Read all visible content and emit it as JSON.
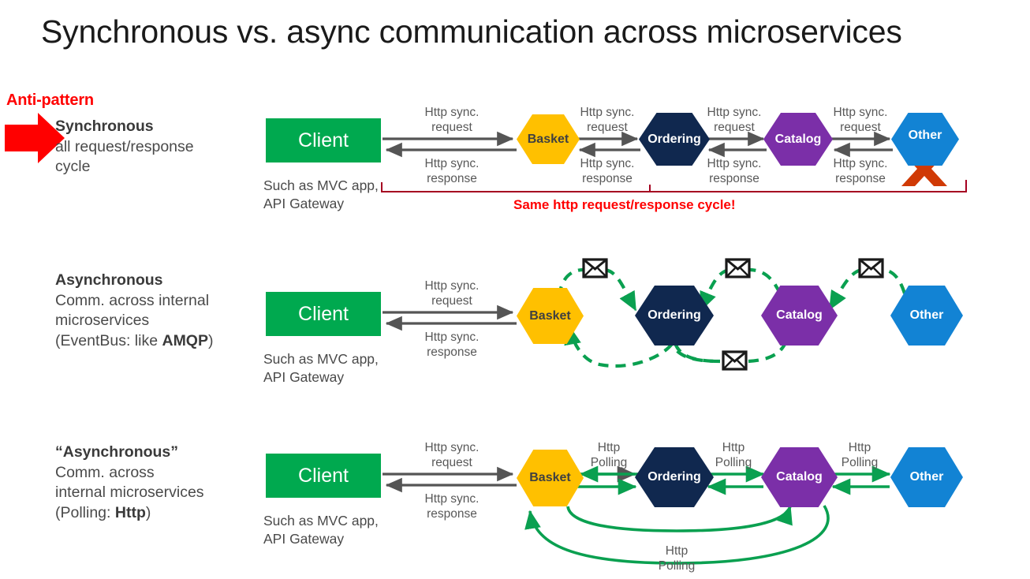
{
  "title": "Synchronous vs. async communication across microservices",
  "colors": {
    "client_green": "#00A94F",
    "basket_amber": "#FFC000",
    "ordering_navy": "#10284F",
    "catalog_purple": "#7B2FA8",
    "other_blue": "#1283D4",
    "arrow_gray": "#555555",
    "async_green": "#00A94F",
    "alert_red": "#FF0000",
    "bracket_red": "#A50021",
    "cross_orange": "#D03A05"
  },
  "rows": [
    {
      "id": "row-synchronous",
      "anti_pattern_label": "Anti-pattern",
      "heading": "Synchronous",
      "body_lines": [
        "all request/response",
        "cycle"
      ],
      "client": {
        "label": "Client",
        "caption_lines": [
          "Such as MVC app,",
          "API Gateway"
        ]
      },
      "services": [
        {
          "name": "Basket",
          "key": "basket"
        },
        {
          "name": "Ordering",
          "key": "ordering"
        },
        {
          "name": "Catalog",
          "key": "catalog"
        },
        {
          "name": "Other",
          "key": "other",
          "crossed_out": true
        }
      ],
      "link_captions": [
        {
          "top": "Http sync.\nrequest",
          "bottom": "Http sync.\nresponse"
        },
        {
          "top": "Http sync.\nrequest",
          "bottom": "Http sync.\nresponse"
        },
        {
          "top": "Http sync.\nrequest",
          "bottom": "Http sync.\nresponse"
        },
        {
          "top": "Http sync.\nrequest",
          "bottom": "Http sync.\nresponse"
        }
      ],
      "caption_top_1": "Http sync.",
      "caption_top_2": "request",
      "caption_bot_1": "Http sync.",
      "caption_bot_2": "response",
      "bracket_label": "Same http request/response  cycle!"
    },
    {
      "id": "row-asynchronous",
      "heading": "Asynchronous",
      "body_lines": [
        "Comm. across internal",
        "microservices",
        "(EventBus: like AMQP)"
      ],
      "body_line3_pre": "(EventBus: like ",
      "body_line3_bold": "AMQP",
      "body_line3_post": ")",
      "client": {
        "label": "Client",
        "caption_lines": [
          "Such as MVC app,",
          "API Gateway"
        ]
      },
      "services": [
        {
          "name": "Basket",
          "key": "basket"
        },
        {
          "name": "Ordering",
          "key": "ordering"
        },
        {
          "name": "Catalog",
          "key": "catalog"
        },
        {
          "name": "Other",
          "key": "other"
        }
      ],
      "caption_top_1": "Http sync.",
      "caption_top_2": "request",
      "caption_bot_1": "Http sync.",
      "caption_bot_2": "response",
      "message_icon": "envelope-icon",
      "message_icon_count": 4
    },
    {
      "id": "row-pseudo-asynchronous",
      "heading": "“Asynchronous”",
      "body_lines": [
        "Comm. across",
        "internal microservices",
        "(Polling: Http)"
      ],
      "body_line3_pre": "(Polling: ",
      "body_line3_bold": "Http",
      "body_line3_post": ")",
      "client": {
        "label": "Client",
        "caption_lines": [
          "Such as MVC app,",
          "API Gateway"
        ]
      },
      "services": [
        {
          "name": "Basket",
          "key": "basket"
        },
        {
          "name": "Ordering",
          "key": "ordering"
        },
        {
          "name": "Catalog",
          "key": "catalog"
        },
        {
          "name": "Other",
          "key": "other"
        }
      ],
      "caption_top_1": "Http sync.",
      "caption_top_2": "request",
      "caption_bot_1": "Http sync.",
      "caption_bot_2": "response",
      "polling_caption_1": "Http",
      "polling_caption_2": "Polling",
      "polling_captions": [
        "Http\nPolling",
        "Http\nPolling",
        "Http\nPolling",
        "Http\nPolling"
      ]
    }
  ]
}
